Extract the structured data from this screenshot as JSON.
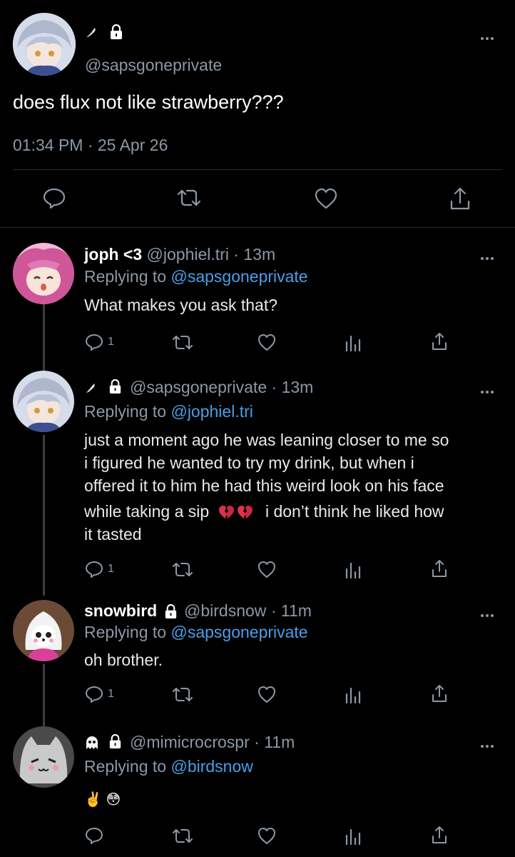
{
  "main_tweet": {
    "handle": "@sapsgoneprivate",
    "text": "does flux not like strawberry???",
    "timestamp": "01:34 PM · 25 Apr 26"
  },
  "replies": [
    {
      "name": "joph <3",
      "handle": "@jophiel.tri",
      "time": "· 13m",
      "replying_label": "Replying to",
      "replying_to": "@sapsgoneprivate",
      "text": "What makes you ask that?",
      "reply_count": "1"
    },
    {
      "handle": "@sapsgoneprivate",
      "time": "· 13m",
      "replying_label": "Replying to",
      "replying_to": "@jophiel.tri",
      "text_lines": [
        "just a moment ago he was leaning closer to me so",
        "i figured he wanted to try my drink, but when i",
        "offered it to him he had this weird look on his face",
        "while taking a sip",
        "i don’t think he liked how",
        "it tasted"
      ],
      "reply_count": "1"
    },
    {
      "name": "snowbird",
      "handle": "@birdsnow",
      "time": "· 11m",
      "replying_label": "Replying to",
      "replying_to": "@sapsgoneprivate",
      "text": "oh brother.",
      "reply_count": "1"
    },
    {
      "handle": "@mimicrocrospr",
      "time": "· 11m",
      "replying_label": "Replying to",
      "replying_to": "@birdsnow",
      "text": "✌️ 😳"
    }
  ],
  "icons": {
    "reply": "speech-bubble-icon",
    "retweet": "retweet-icon",
    "like": "heart-icon",
    "views": "bar-chart-icon",
    "share": "share-icon",
    "more": "more-dots-icon",
    "lock": "lock-icon"
  },
  "colors": {
    "background": "#000000",
    "text": "#e7e9ea",
    "muted": "#8b98a5",
    "link": "#4a9ee8"
  }
}
